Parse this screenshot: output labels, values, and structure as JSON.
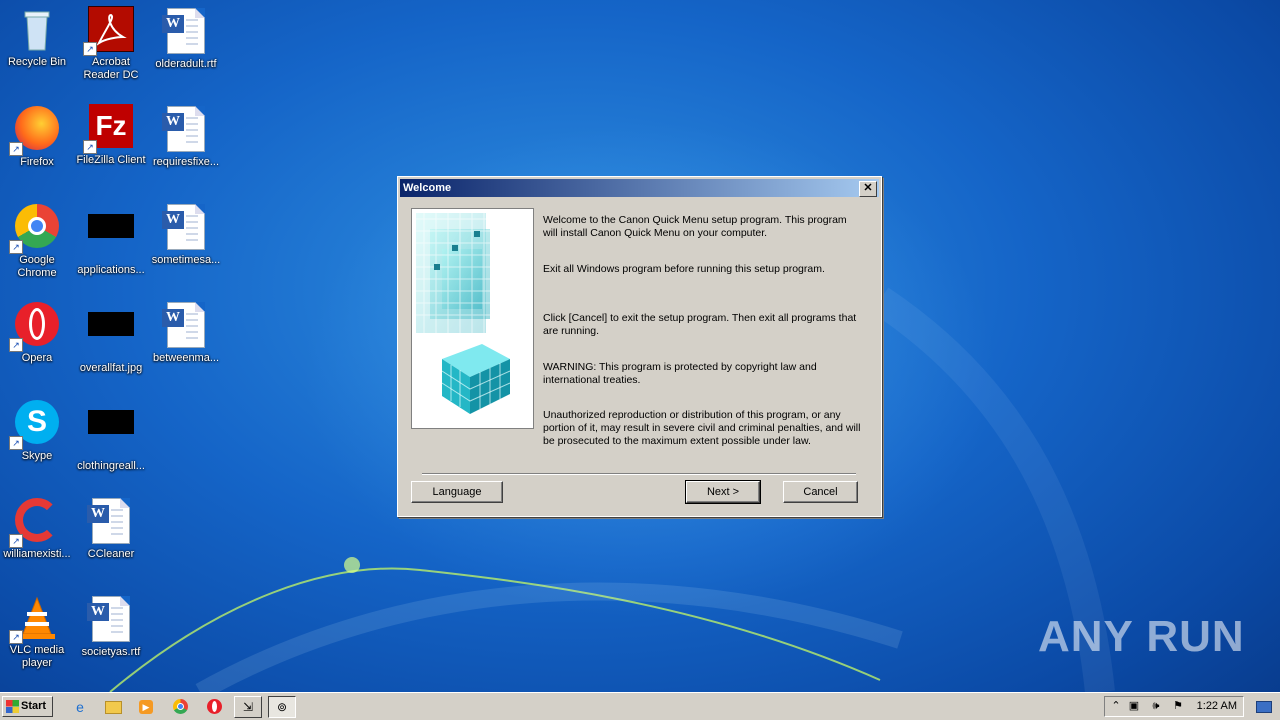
{
  "desktop": {
    "icons": [
      {
        "label": "Recycle Bin",
        "icon": "recycle-bin-icon"
      },
      {
        "label": "Acrobat Reader DC",
        "icon": "acrobat-icon"
      },
      {
        "label": "olderadult.rtf",
        "icon": "word-document-icon"
      },
      {
        "label": "Firefox",
        "icon": "firefox-icon"
      },
      {
        "label": "FileZilla Client",
        "icon": "filezilla-icon"
      },
      {
        "label": "requiresfixe...",
        "icon": "word-document-icon"
      },
      {
        "label": "Google Chrome",
        "icon": "chrome-icon"
      },
      {
        "label": "applications...",
        "icon": "image-thumbnail-icon"
      },
      {
        "label": "sometimesa...",
        "icon": "word-document-icon"
      },
      {
        "label": "Opera",
        "icon": "opera-icon"
      },
      {
        "label": "overallfat.jpg",
        "icon": "image-thumbnail-icon"
      },
      {
        "label": "betweenma...",
        "icon": "word-document-icon"
      },
      {
        "label": "Skype",
        "icon": "skype-icon"
      },
      {
        "label": "clothingreall...",
        "icon": "image-thumbnail-icon"
      },
      {
        "label": "CCleaner",
        "icon": "ccleaner-icon"
      },
      {
        "label": "williamexisti...",
        "icon": "word-document-icon"
      },
      {
        "label": "VLC media player",
        "icon": "vlc-icon"
      },
      {
        "label": "societyas.rtf",
        "icon": "word-document-icon"
      }
    ],
    "watermark": "ANY RUN"
  },
  "dialog": {
    "title": "Welcome",
    "close_symbol": "✕",
    "paragraphs": [
      "Welcome to the Canon Quick Menu setup program. This program will install Canon Quick Menu on your computer.",
      "Exit all Windows program before running this setup program.",
      "Click [Cancel] to exit the setup program. Then exit all programs that are running.",
      "WARNING: This program is protected by copyright law and international treaties.",
      "Unauthorized reproduction or distribution of this program, or any portion of it, may result in severe civil and criminal penalties, and will be prosecuted to the maximum extent possible under law."
    ],
    "buttons": {
      "language": "Language",
      "next": "Next >",
      "cancel": "Cancel"
    }
  },
  "taskbar": {
    "start_label": "Start",
    "clock": "1:22 AM",
    "quicklaunch": [
      "internet-explorer-icon",
      "explorer-folder-icon",
      "media-player-icon",
      "chrome-icon",
      "opera-icon"
    ],
    "tasks": [
      "setup-task-icon",
      "welcome-task-icon"
    ]
  },
  "colors": {
    "titlebar_start": "#0a246a",
    "titlebar_end": "#a6caf0",
    "dialog_face": "#d4d0c8",
    "desktop_blue": "#1565c8"
  }
}
